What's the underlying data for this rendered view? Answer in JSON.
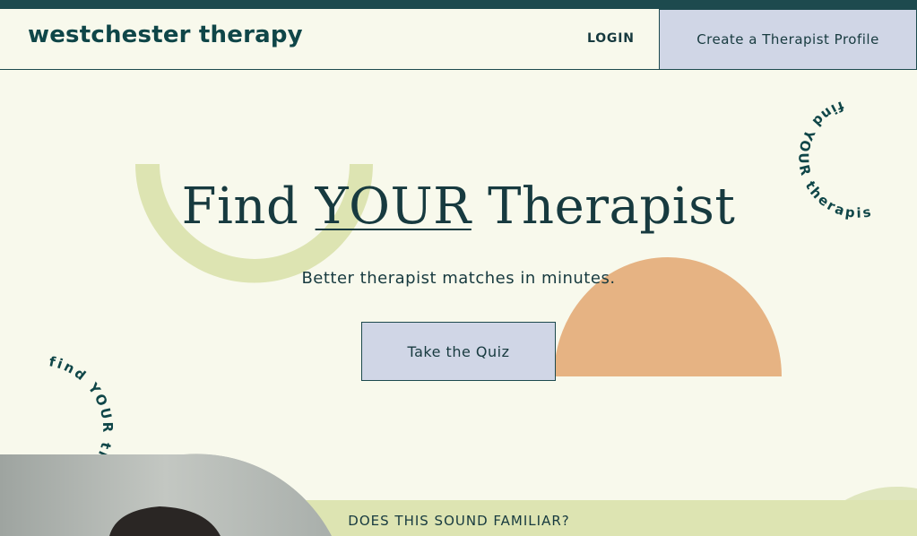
{
  "header": {
    "logo": "westchester therapy",
    "login_label": "LOGIN",
    "create_profile_label": "Create a Therapist Profile"
  },
  "hero": {
    "title_before": "Find ",
    "title_emphasis": "YOUR",
    "title_after": " Therapist",
    "subtitle": "Better therapist matches in minutes.",
    "cta_label": "Take the Quiz"
  },
  "circular_text": {
    "top_right": "find YOUR therapist",
    "left": "find YOUR therapist"
  },
  "section": {
    "familiar_heading": "DOES THIS SOUND FAMILIAR?"
  },
  "colors": {
    "dark_teal": "#1d4a4e",
    "background": "#f8f9ec",
    "lavender": "#d0d6e6",
    "sage": "#dde4b2",
    "peach": "#e6b383"
  }
}
